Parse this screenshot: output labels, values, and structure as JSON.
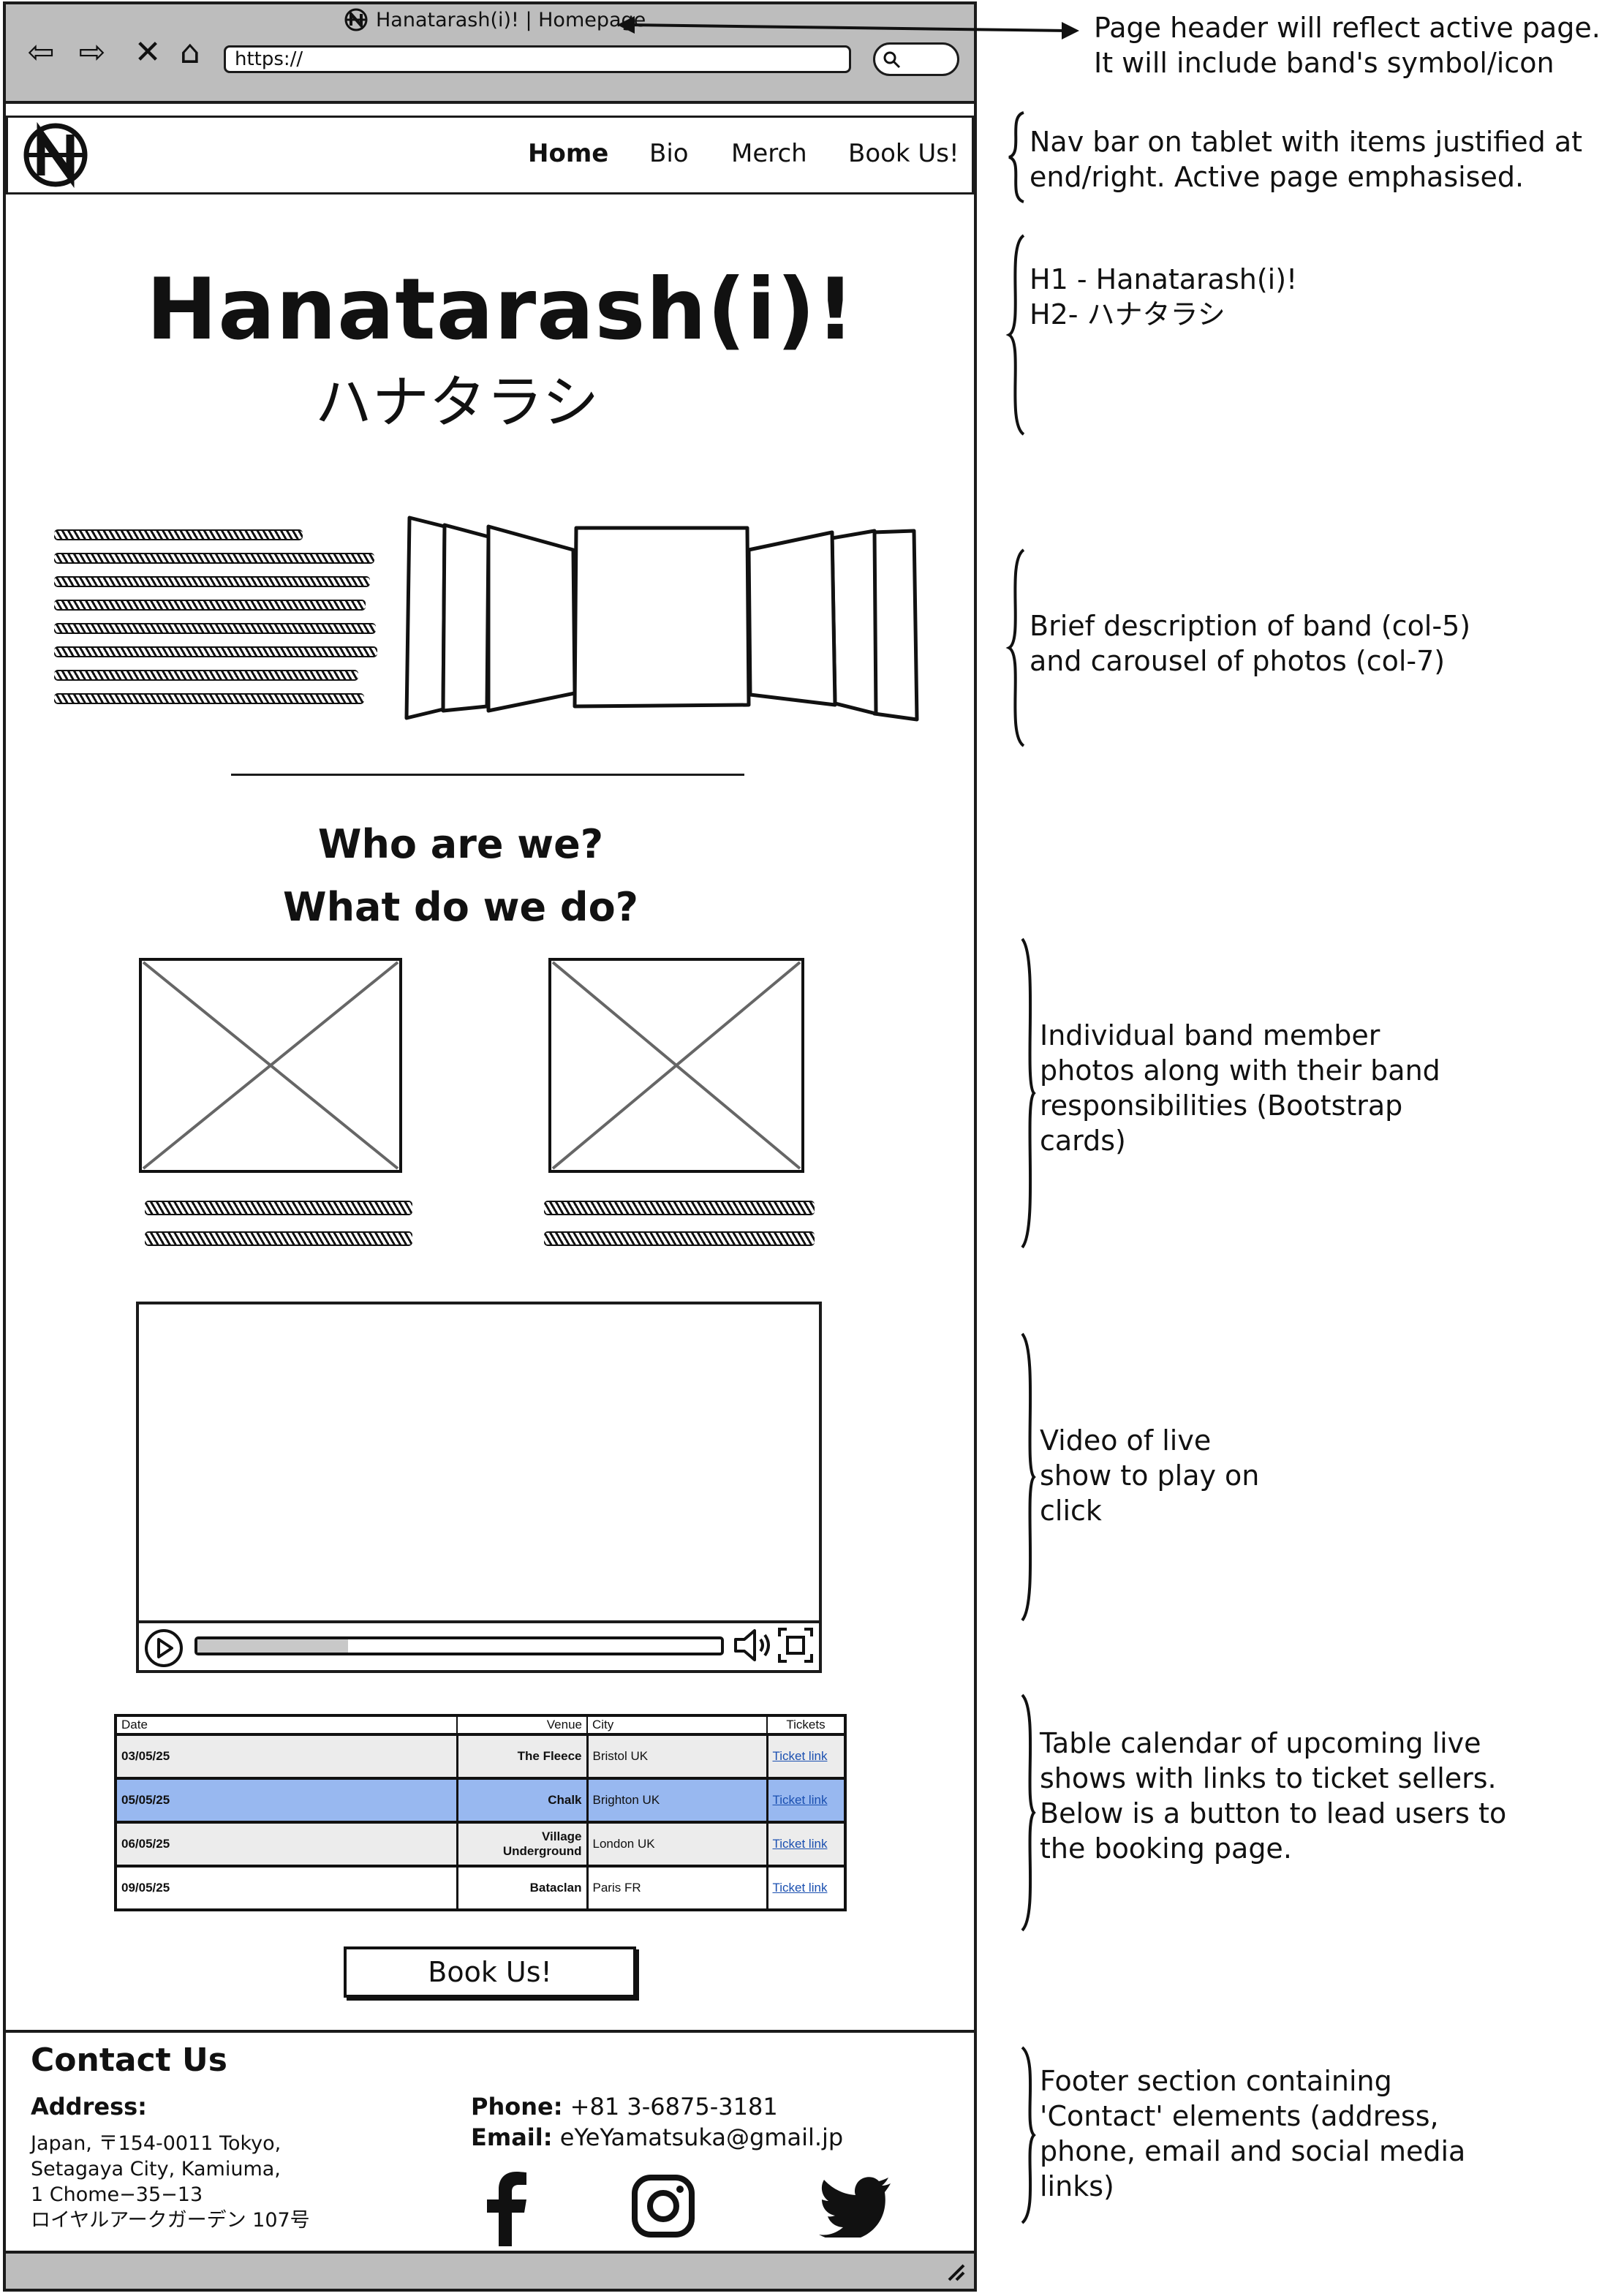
{
  "browser": {
    "tab_title": "Hanatarash(i)! | Homepage",
    "url": "https://"
  },
  "nav": {
    "items": [
      {
        "label": "Home",
        "active": true
      },
      {
        "label": "Bio",
        "active": false
      },
      {
        "label": "Merch",
        "active": false
      },
      {
        "label": "Book Us!",
        "active": false
      }
    ]
  },
  "hero": {
    "h1": "Hanatarash(i)!",
    "h2": "ハナタラシ"
  },
  "who": {
    "line1": "Who are we?",
    "line2": "What do we do?"
  },
  "shows_table": {
    "headers": [
      "Date",
      "Venue",
      "City",
      "Tickets"
    ],
    "rows": [
      {
        "date": "03/05/25",
        "venue": "The Fleece",
        "city": "Bristol UK",
        "tickets": "Ticket link"
      },
      {
        "date": "05/05/25",
        "venue": "Chalk",
        "city": "Brighton UK",
        "tickets": "Ticket link"
      },
      {
        "date": "06/05/25",
        "venue": "Village Underground",
        "city": "London UK",
        "tickets": "Ticket link"
      },
      {
        "date": "09/05/25",
        "venue": "Bataclan",
        "city": "Paris FR",
        "tickets": "Ticket link"
      }
    ],
    "highlight_color": "#98b8f0"
  },
  "book_button": "Book Us!",
  "footer": {
    "heading": "Contact Us",
    "address_label": "Address:",
    "address_lines": [
      "Japan, 〒154-0011 Tokyo,",
      "Setagaya City, Kamiuma,",
      "1 Chome−35−13",
      "ロイヤルアークガーデン 107号"
    ],
    "phone_label": "Phone:",
    "phone": "+81 3-6875-3181",
    "email_label": "Email:",
    "email": "eYeYamatsuka@gmail.jp"
  },
  "annotations": {
    "header": "Page header will reflect active page.\nIt will include band's symbol/icon",
    "nav": "Nav bar on tablet with items justified at\nend/right. Active page emphasised.",
    "headings": "H1 - Hanatarash(i)!\nH2- ハナタラシ",
    "description": "Brief description of band (col-5)\nand carousel of photos (col-7)",
    "members": "Individual band member\nphotos along with their band\nresponsibilities (Bootstrap\ncards)",
    "video": "Video of live\nshow to play on\nclick",
    "table": "Table calendar of upcoming live\nshows with links to ticket sellers.\nBelow is a button to lead users to\nthe booking page.",
    "footer": "Footer section containing\n'Contact' elements (address,\nphone, email and social media\nlinks)"
  }
}
